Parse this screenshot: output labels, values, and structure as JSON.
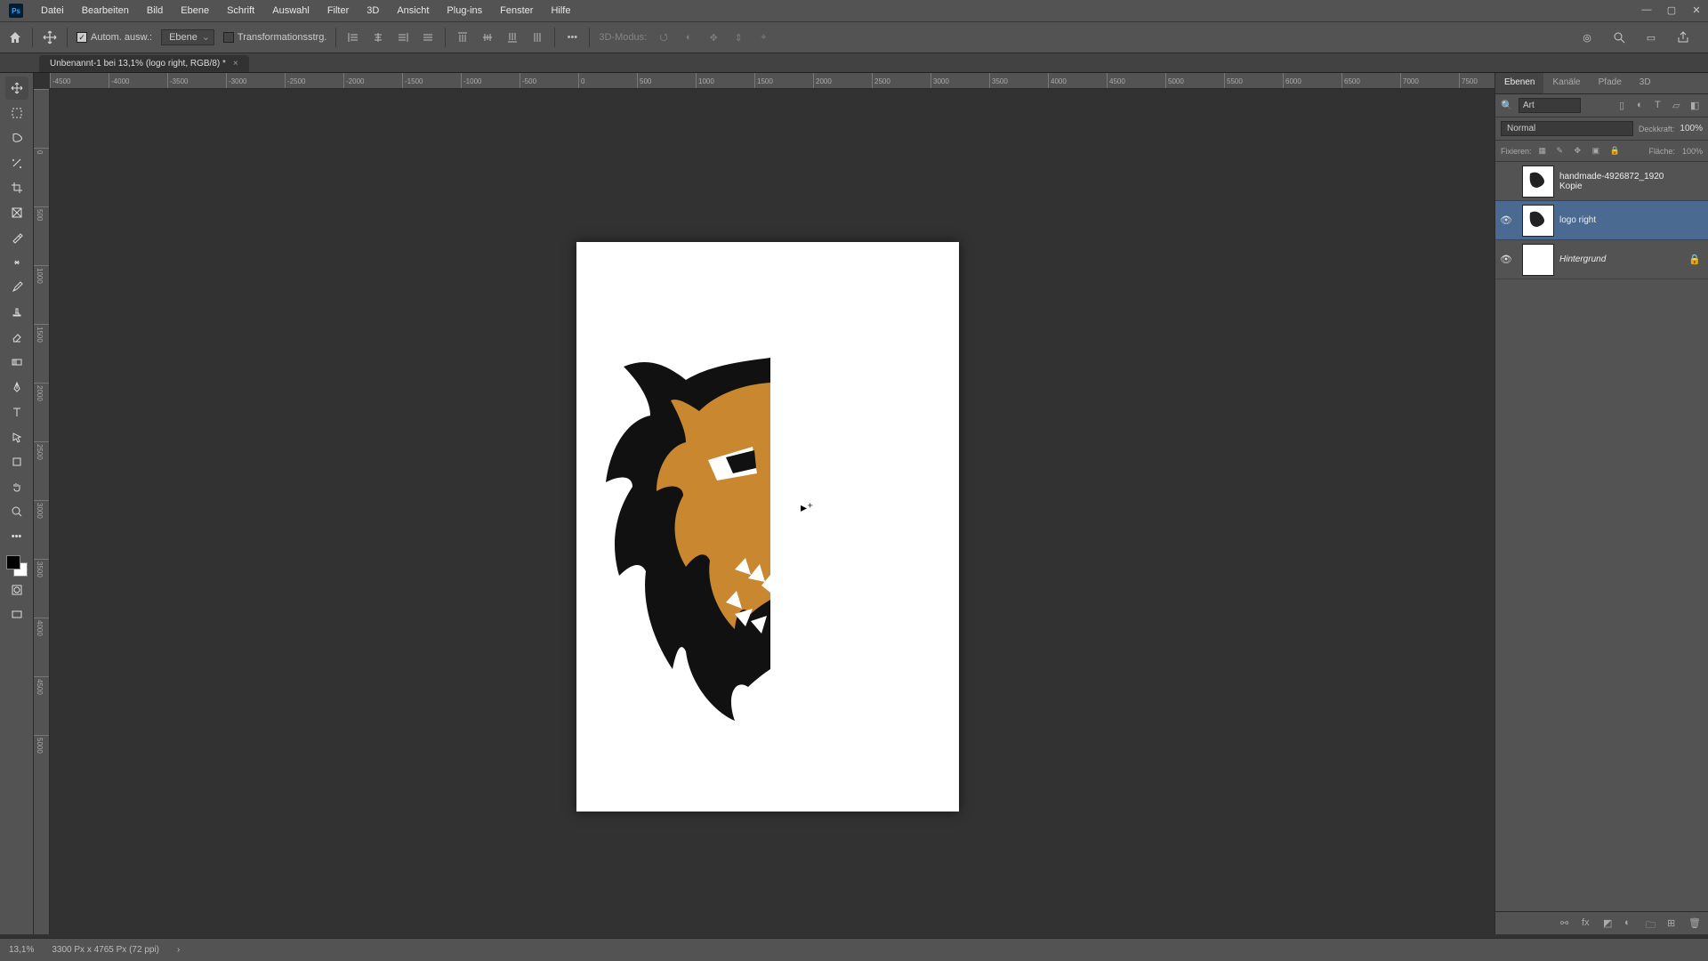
{
  "menu": [
    "Datei",
    "Bearbeiten",
    "Bild",
    "Ebene",
    "Schrift",
    "Auswahl",
    "Filter",
    "3D",
    "Ansicht",
    "Plug-ins",
    "Fenster",
    "Hilfe"
  ],
  "options": {
    "auto_select": "Autom. ausw.:",
    "dd": "Ebene",
    "transform": "Transformationsstrg.",
    "mode3d": "3D-Modus:"
  },
  "doc_tab": "Unbenannt-1 bei 13,1% (logo right, RGB/8) *",
  "ruler_h": [
    "-4500",
    "-4000",
    "-3500",
    "-3000",
    "-2500",
    "-2000",
    "-1500",
    "-1000",
    "-500",
    "0",
    "500",
    "1000",
    "1500",
    "2000",
    "2500",
    "3000",
    "3500",
    "4000",
    "4500",
    "5000",
    "5500",
    "6000",
    "6500",
    "7000",
    "7500"
  ],
  "ruler_v": [
    "",
    "0",
    "500",
    "1000",
    "1500",
    "2000",
    "2500",
    "3000",
    "3500",
    "4000",
    "4500",
    "5000"
  ],
  "panel": {
    "tabs": [
      "Ebenen",
      "Kanäle",
      "Pfade",
      "3D"
    ],
    "filter": "Art",
    "blend_mode": "Normal",
    "opacity_label": "Deckkraft:",
    "opacity": "100%",
    "lock_label": "Fixieren:",
    "fill_label": "Fläche:",
    "fill": "100%"
  },
  "layers": [
    {
      "visible": false,
      "name": "handmade-4926872_1920 Kopie",
      "locked": false
    },
    {
      "visible": true,
      "name": "logo right",
      "locked": false
    },
    {
      "visible": true,
      "name": "Hintergrund",
      "locked": true
    }
  ],
  "status": {
    "zoom": "13,1%",
    "docinfo": "3300 Px x 4765 Px (72 ppi)"
  }
}
